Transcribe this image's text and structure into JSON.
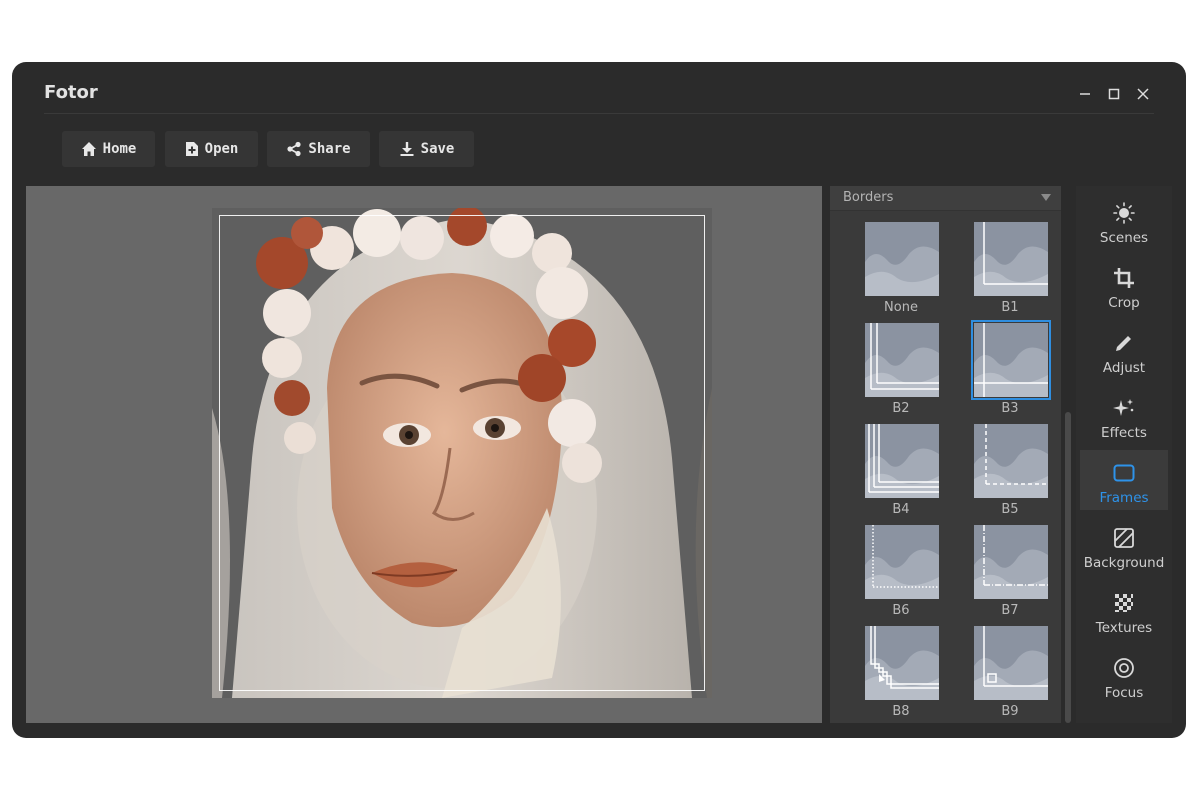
{
  "app": {
    "title": "Fotor"
  },
  "window_controls": {
    "minimize": "minimize-icon",
    "maximize": "maximize-icon",
    "close": "close-icon"
  },
  "toolbar": {
    "home_label": "Home",
    "open_label": "Open",
    "share_label": "Share",
    "save_label": "Save"
  },
  "panel": {
    "title": "Borders",
    "items": [
      {
        "label": "None",
        "style": "none"
      },
      {
        "label": "B1",
        "style": "b1"
      },
      {
        "label": "B2",
        "style": "b2"
      },
      {
        "label": "B3",
        "style": "b3",
        "selected": true
      },
      {
        "label": "B4",
        "style": "b4"
      },
      {
        "label": "B5",
        "style": "b5"
      },
      {
        "label": "B6",
        "style": "b6"
      },
      {
        "label": "B7",
        "style": "b7"
      },
      {
        "label": "B8",
        "style": "b8"
      },
      {
        "label": "B9",
        "style": "b9"
      }
    ]
  },
  "nav": {
    "items": [
      {
        "label": "Scenes",
        "icon": "sun-icon"
      },
      {
        "label": "Crop",
        "icon": "crop-icon"
      },
      {
        "label": "Adjust",
        "icon": "pencil-icon"
      },
      {
        "label": "Effects",
        "icon": "sparkle-icon"
      },
      {
        "label": "Frames",
        "icon": "frame-icon",
        "active": true
      },
      {
        "label": "Background",
        "icon": "background-icon"
      },
      {
        "label": "Textures",
        "icon": "texture-icon"
      },
      {
        "label": "Focus",
        "icon": "focus-icon"
      }
    ]
  },
  "colors": {
    "accent": "#2e93ea",
    "window_bg": "#2b2b2b",
    "canvas_bg": "#686868"
  }
}
